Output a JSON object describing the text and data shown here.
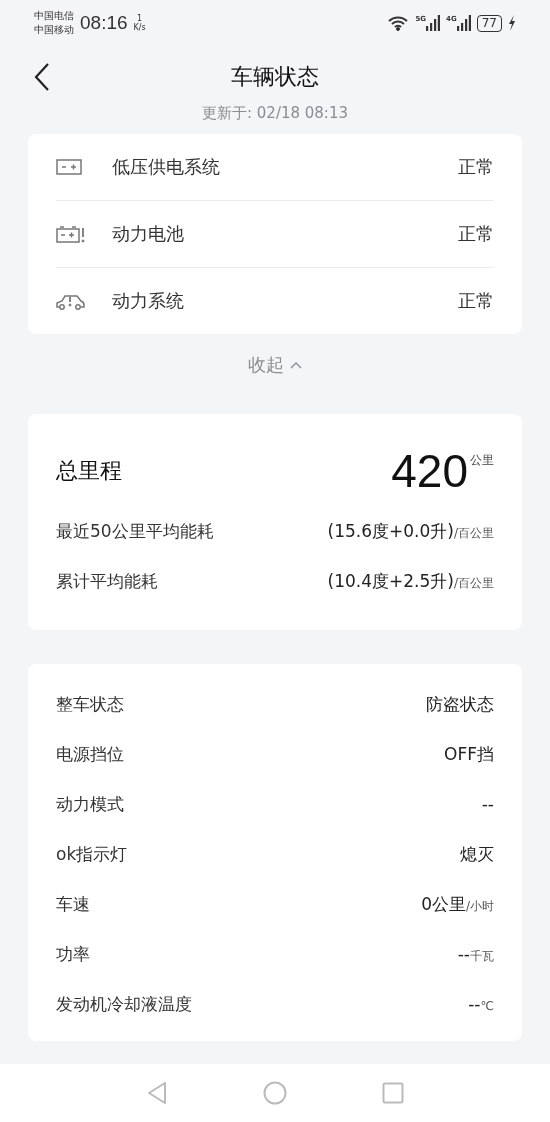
{
  "status_bar": {
    "carriers": [
      "中国电信",
      "中国移动"
    ],
    "time": "08:16",
    "speed_value": "1",
    "speed_unit": "K/s",
    "network_1": "5G",
    "network_2": "4G",
    "battery": "77"
  },
  "header": {
    "title": "车辆状态",
    "updated": "更新于: 02/18 08:13"
  },
  "systems": [
    {
      "kind": "low-voltage",
      "name": "低压供电系统",
      "status": "正常"
    },
    {
      "kind": "battery",
      "name": "动力电池",
      "status": "正常"
    },
    {
      "kind": "powertrain",
      "name": "动力系统",
      "status": "正常"
    }
  ],
  "collapse": {
    "label": "收起",
    "expanded": true
  },
  "mileage": {
    "label": "总里程",
    "value": "420",
    "unit": "公里",
    "consumption": [
      {
        "label": "最近50公里平均能耗",
        "value": "(15.6度+0.0升)",
        "unit": "/百公里"
      },
      {
        "label": "累计平均能耗",
        "value": "(10.4度+2.5升)",
        "unit": "/百公里"
      }
    ]
  },
  "vehicle": [
    {
      "label": "整车状态",
      "value": "防盗状态"
    },
    {
      "label": "电源挡位",
      "value": "OFF挡"
    },
    {
      "label": "动力模式",
      "value": "--"
    },
    {
      "label": "ok指示灯",
      "value": "熄灭"
    },
    {
      "label": "车速",
      "value": "0公里",
      "unit": "/小时"
    },
    {
      "label": "功率",
      "value": "--",
      "unit": "千瓦"
    },
    {
      "label": "发动机冷却液温度",
      "value": "--",
      "unit": "℃"
    }
  ]
}
